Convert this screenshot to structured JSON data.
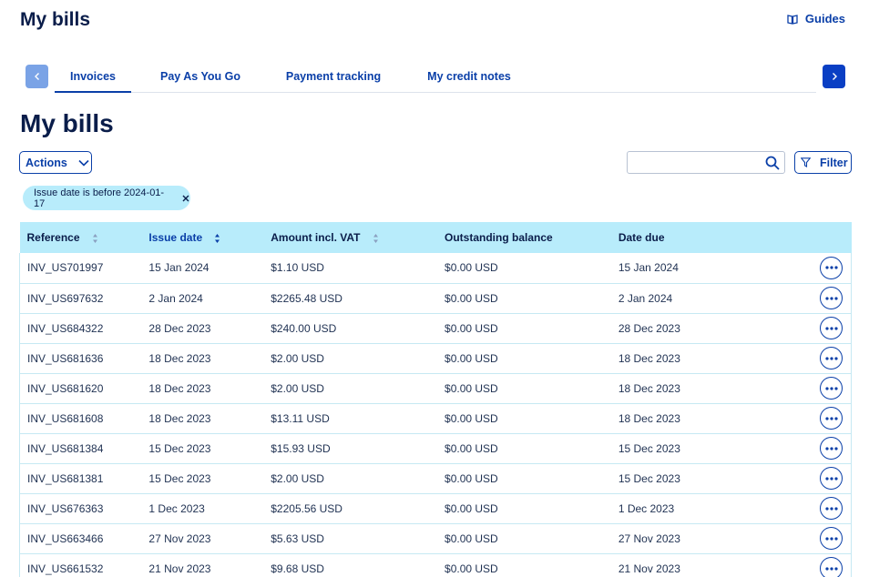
{
  "header": {
    "title": "My bills",
    "guides_label": "Guides"
  },
  "tabs": [
    {
      "label": "Invoices",
      "active": true
    },
    {
      "label": "Pay As You Go",
      "active": false
    },
    {
      "label": "Payment tracking",
      "active": false
    },
    {
      "label": "My credit notes",
      "active": false
    }
  ],
  "page": {
    "title": "My bills"
  },
  "toolbar": {
    "actions_label": "Actions",
    "filter_label": "Filter",
    "search_placeholder": "",
    "search_value": ""
  },
  "active_filter": {
    "label": "Issue date is before 2024-01-17"
  },
  "table": {
    "columns": [
      "Reference",
      "Issue date",
      "Amount incl. VAT",
      "Outstanding balance",
      "Date due"
    ],
    "rows": [
      [
        "INV_US701997",
        "15 Jan 2024",
        "$1.10 USD",
        "$0.00 USD",
        "15 Jan 2024"
      ],
      [
        "INV_US697632",
        "2 Jan 2024",
        "$2265.48 USD",
        "$0.00 USD",
        "2 Jan 2024"
      ],
      [
        "INV_US684322",
        "28 Dec 2023",
        "$240.00 USD",
        "$0.00 USD",
        "28 Dec 2023"
      ],
      [
        "INV_US681636",
        "18 Dec 2023",
        "$2.00 USD",
        "$0.00 USD",
        "18 Dec 2023"
      ],
      [
        "INV_US681620",
        "18 Dec 2023",
        "$2.00 USD",
        "$0.00 USD",
        "18 Dec 2023"
      ],
      [
        "INV_US681608",
        "18 Dec 2023",
        "$13.11 USD",
        "$0.00 USD",
        "18 Dec 2023"
      ],
      [
        "INV_US681384",
        "15 Dec 2023",
        "$15.93 USD",
        "$0.00 USD",
        "15 Dec 2023"
      ],
      [
        "INV_US681381",
        "15 Dec 2023",
        "$2.00 USD",
        "$0.00 USD",
        "15 Dec 2023"
      ],
      [
        "INV_US676363",
        "1 Dec 2023",
        "$2205.56 USD",
        "$0.00 USD",
        "1 Dec 2023"
      ],
      [
        "INV_US663466",
        "27 Nov 2023",
        "$5.63 USD",
        "$0.00 USD",
        "27 Nov 2023"
      ],
      [
        "INV_US661532",
        "21 Nov 2023",
        "$9.68 USD",
        "$0.00 USD",
        "21 Nov 2023"
      ]
    ]
  },
  "icons": {
    "guides": "book-icon",
    "tab_prev": "chevron-left-icon",
    "tab_next": "chevron-right-icon",
    "actions": "chevron-down-icon",
    "search": "search-icon",
    "filter": "filter-icon",
    "chip_close": "close-icon",
    "sort": "sort-icon",
    "row_menu": "more-horizontal-icon"
  },
  "colors": {
    "primary": "#0a3fa8",
    "header_bg": "#b8ecfb",
    "chip_bg": "#b8ecfb",
    "title": "#0a1d4a"
  }
}
